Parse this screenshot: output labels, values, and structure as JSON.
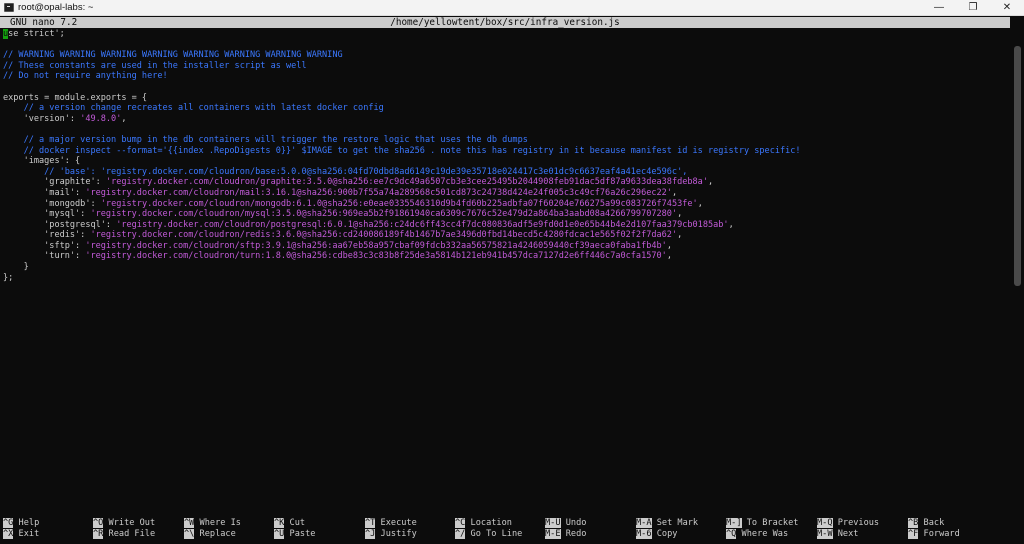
{
  "window": {
    "title": "root@opal-labs: ~",
    "controls": {
      "minimize": "—",
      "maximize": "❐",
      "close": "✕"
    }
  },
  "nano": {
    "version": "GNU nano 7.2",
    "file_path": "/home/yellowtent/box/src/infra_version.js"
  },
  "editor": {
    "lines": [
      {
        "segments": [
          {
            "t": "u",
            "c": "cursor"
          },
          {
            "t": "se strict';",
            "c": "default"
          }
        ]
      },
      {
        "segments": []
      },
      {
        "segments": [
          {
            "t": "// WARNING WARNING WARNING WARNING WARNING WARNING WARNING WARNING",
            "c": "comment"
          }
        ]
      },
      {
        "segments": [
          {
            "t": "// These constants are used in the installer script as well",
            "c": "comment"
          }
        ]
      },
      {
        "segments": [
          {
            "t": "// Do not require anything here!",
            "c": "comment"
          }
        ]
      },
      {
        "segments": []
      },
      {
        "segments": [
          {
            "t": "exports = module.exports = {",
            "c": "default"
          }
        ]
      },
      {
        "segments": [
          {
            "t": "    // a version change recreates all containers with latest docker config",
            "c": "comment"
          }
        ]
      },
      {
        "segments": [
          {
            "t": "    'version': ",
            "c": "default"
          },
          {
            "t": "'49.8.0'",
            "c": "string"
          },
          {
            "t": ",",
            "c": "default"
          }
        ]
      },
      {
        "segments": []
      },
      {
        "segments": [
          {
            "t": "    // a major version bump in the db containers will trigger the restore logic that uses the db dumps",
            "c": "comment"
          }
        ]
      },
      {
        "segments": [
          {
            "t": "    // docker inspect --format='{{index .RepoDigests 0}}' $IMAGE to get the sha256 . note this has registry in it because manifest id is registry specific!",
            "c": "comment"
          }
        ]
      },
      {
        "segments": [
          {
            "t": "    'images': {",
            "c": "default"
          }
        ]
      },
      {
        "segments": [
          {
            "t": "        // 'base': 'registry.docker.com/cloudron/base:5.0.0@sha256:04fd70dbd8ad6149c19de39e35718e024417c3e01dc9c6637eaf4a41ec4e596c',",
            "c": "comment"
          }
        ]
      },
      {
        "segments": [
          {
            "t": "        'graphite': ",
            "c": "default"
          },
          {
            "t": "'registry.docker.com/cloudron/graphite:3.5.0@sha256:ee7c9dc49a6507cb3e3cee25495b2044908feb91dac5df87a9633dea38fdeb8a'",
            "c": "string"
          },
          {
            "t": ",",
            "c": "default"
          }
        ]
      },
      {
        "segments": [
          {
            "t": "        'mail': ",
            "c": "default"
          },
          {
            "t": "'registry.docker.com/cloudron/mail:3.16.1@sha256:900b7f55a74a289568c501cd873c24738d424e24f005c3c49cf76a26c296ec22'",
            "c": "string"
          },
          {
            "t": ",",
            "c": "default"
          }
        ]
      },
      {
        "segments": [
          {
            "t": "        'mongodb': ",
            "c": "default"
          },
          {
            "t": "'registry.docker.com/cloudron/mongodb:6.1.0@sha256:e0eae0335546310d9b4fd60b225adbfa07f60204e766275a99c083726f7453fe'",
            "c": "string"
          },
          {
            "t": ",",
            "c": "default"
          }
        ]
      },
      {
        "segments": [
          {
            "t": "        'mysql': ",
            "c": "default"
          },
          {
            "t": "'registry.docker.com/cloudron/mysql:3.5.0@sha256:969ea5b2f91861940ca6309c7676c52e479d2a864ba3aabd08a4266799707280'",
            "c": "string"
          },
          {
            "t": ",",
            "c": "default"
          }
        ]
      },
      {
        "segments": [
          {
            "t": "        'postgresql': ",
            "c": "default"
          },
          {
            "t": "'registry.docker.com/cloudron/postgresql:6.0.1@sha256:c24dc6ff43cc4f7dc080836adf5e9fd0d1e0e65b44b4e2d107faa379cb0185ab'",
            "c": "string"
          },
          {
            "t": ",",
            "c": "default"
          }
        ]
      },
      {
        "segments": [
          {
            "t": "        'redis': ",
            "c": "default"
          },
          {
            "t": "'registry.docker.com/cloudron/redis:3.6.0@sha256:cd240086189f4b1467b7ae3496d0fbd14becd5c4280fdcac1e565f02f2f7da62'",
            "c": "string"
          },
          {
            "t": ",",
            "c": "default"
          }
        ]
      },
      {
        "segments": [
          {
            "t": "        'sftp': ",
            "c": "default"
          },
          {
            "t": "'registry.docker.com/cloudron/sftp:3.9.1@sha256:aa67eb58a957cbaf09fdcb332aa56575821a4246059440cf39aeca0faba1fb4b'",
            "c": "string"
          },
          {
            "t": ",",
            "c": "default"
          }
        ]
      },
      {
        "segments": [
          {
            "t": "        'turn': ",
            "c": "default"
          },
          {
            "t": "'registry.docker.com/cloudron/turn:1.8.0@sha256:cdbe83c3c83b8f25de3a5814b121eb941b457dca7127d2e6ff446c7a0cfa1570'",
            "c": "string"
          },
          {
            "t": ",",
            "c": "default"
          }
        ]
      },
      {
        "segments": [
          {
            "t": "    }",
            "c": "default"
          }
        ]
      },
      {
        "segments": [
          {
            "t": "};",
            "c": "default"
          }
        ]
      }
    ]
  },
  "shortcuts": [
    {
      "top": {
        "key": "^G",
        "label": "Help"
      },
      "bottom": {
        "key": "^X",
        "label": "Exit"
      }
    },
    {
      "top": {
        "key": "^O",
        "label": "Write Out"
      },
      "bottom": {
        "key": "^R",
        "label": "Read File"
      }
    },
    {
      "top": {
        "key": "^W",
        "label": "Where Is"
      },
      "bottom": {
        "key": "^\\",
        "label": "Replace"
      }
    },
    {
      "top": {
        "key": "^K",
        "label": "Cut"
      },
      "bottom": {
        "key": "^U",
        "label": "Paste"
      }
    },
    {
      "top": {
        "key": "^T",
        "label": "Execute"
      },
      "bottom": {
        "key": "^J",
        "label": "Justify"
      }
    },
    {
      "top": {
        "key": "^C",
        "label": "Location"
      },
      "bottom": {
        "key": "^/",
        "label": "Go To Line"
      }
    },
    {
      "top": {
        "key": "M-U",
        "label": "Undo"
      },
      "bottom": {
        "key": "M-E",
        "label": "Redo"
      }
    },
    {
      "top": {
        "key": "M-A",
        "label": "Set Mark"
      },
      "bottom": {
        "key": "M-6",
        "label": "Copy"
      }
    },
    {
      "top": {
        "key": "M-]",
        "label": "To Bracket"
      },
      "bottom": {
        "key": "^Q",
        "label": "Where Was"
      }
    },
    {
      "top": {
        "key": "M-Q",
        "label": "Previous"
      },
      "bottom": {
        "key": "M-W",
        "label": "Next"
      }
    },
    {
      "top": {
        "key": "^B",
        "label": "Back"
      },
      "bottom": {
        "key": "^F",
        "label": "Forward"
      }
    }
  ]
}
